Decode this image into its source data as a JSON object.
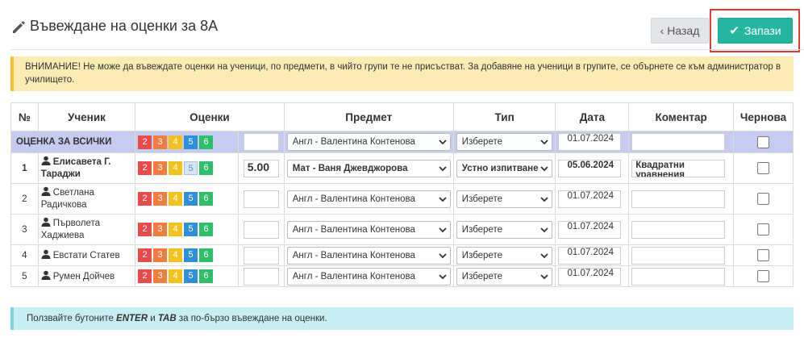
{
  "header": {
    "title": "Въвеждане на оценки за 8А",
    "back_label": "Назад",
    "save_label": "Запази"
  },
  "warning": "ВНИМАНИЕ! Не може да въвеждате оценки на ученици, по предмети, в чийто групи те не присъстват. За добавяне на ученици в групите, се обърнете се към администратор в училището.",
  "table": {
    "columns": [
      "№",
      "Ученик",
      "Оценки",
      "Предмет",
      "Тип",
      "Дата",
      "Коментар",
      "Чернова"
    ],
    "grade_buttons": [
      "2",
      "3",
      "4",
      "5",
      "6"
    ],
    "all_row": {
      "label": "ОЦЕНКА ЗА ВСИЧКИ",
      "grade": "",
      "subject": "Англ - Валентина Контенова",
      "type": "Изберете",
      "date": "01.07.2024",
      "comment": ""
    },
    "rows": [
      {
        "num": "1",
        "name_line1": "Елисавета Г.",
        "name_line2": "Тараджи",
        "grade": "5.00",
        "subject": "Мат - Ваня Джевджорова",
        "type": "Устно изпитване",
        "date": "05.06.2024",
        "comment": "Квадратни уравнения"
      },
      {
        "num": "2",
        "name_line1": "Светлана",
        "name_line2": "Радичкова",
        "grade": "",
        "subject": "Англ - Валентина Контенова",
        "type": "Изберете",
        "date": "01.07.2024",
        "comment": ""
      },
      {
        "num": "3",
        "name_line1": "Първолета",
        "name_line2": "Хаджиева",
        "grade": "",
        "subject": "Англ - Валентина Контенова",
        "type": "Изберете",
        "date": "01.07.2024",
        "comment": ""
      },
      {
        "num": "4",
        "name_line1": "Евстати Статев",
        "name_line2": "",
        "grade": "",
        "subject": "Англ - Валентина Контенова",
        "type": "Изберете",
        "date": "01.07.2024",
        "comment": ""
      },
      {
        "num": "5",
        "name_line1": "Румен Дойчев",
        "name_line2": "",
        "grade": "",
        "subject": "Англ - Валентина Контенова",
        "type": "Изберете",
        "date": "01.07.2024",
        "comment": ""
      }
    ]
  },
  "info": {
    "prefix": "Ползвайте бутоните ",
    "key1": "ENTER",
    "mid": " и ",
    "key2": "TAB",
    "suffix": " за по-бързо въвеждане на оценки."
  },
  "colors": {
    "save": "#26b5a0",
    "grade_2": "#e94a4a",
    "grade_3": "#f07c3f",
    "grade_4": "#f3c21e",
    "grade_5": "#2f8fd8",
    "grade_6": "#2fbf6a",
    "all_row": "#c6ccef",
    "warning": "#fcebb4",
    "info": "#c8eef4"
  },
  "icons": [
    "pencil-icon",
    "chevron-left-icon",
    "check-icon",
    "user-icon",
    "caret-down-icon"
  ]
}
